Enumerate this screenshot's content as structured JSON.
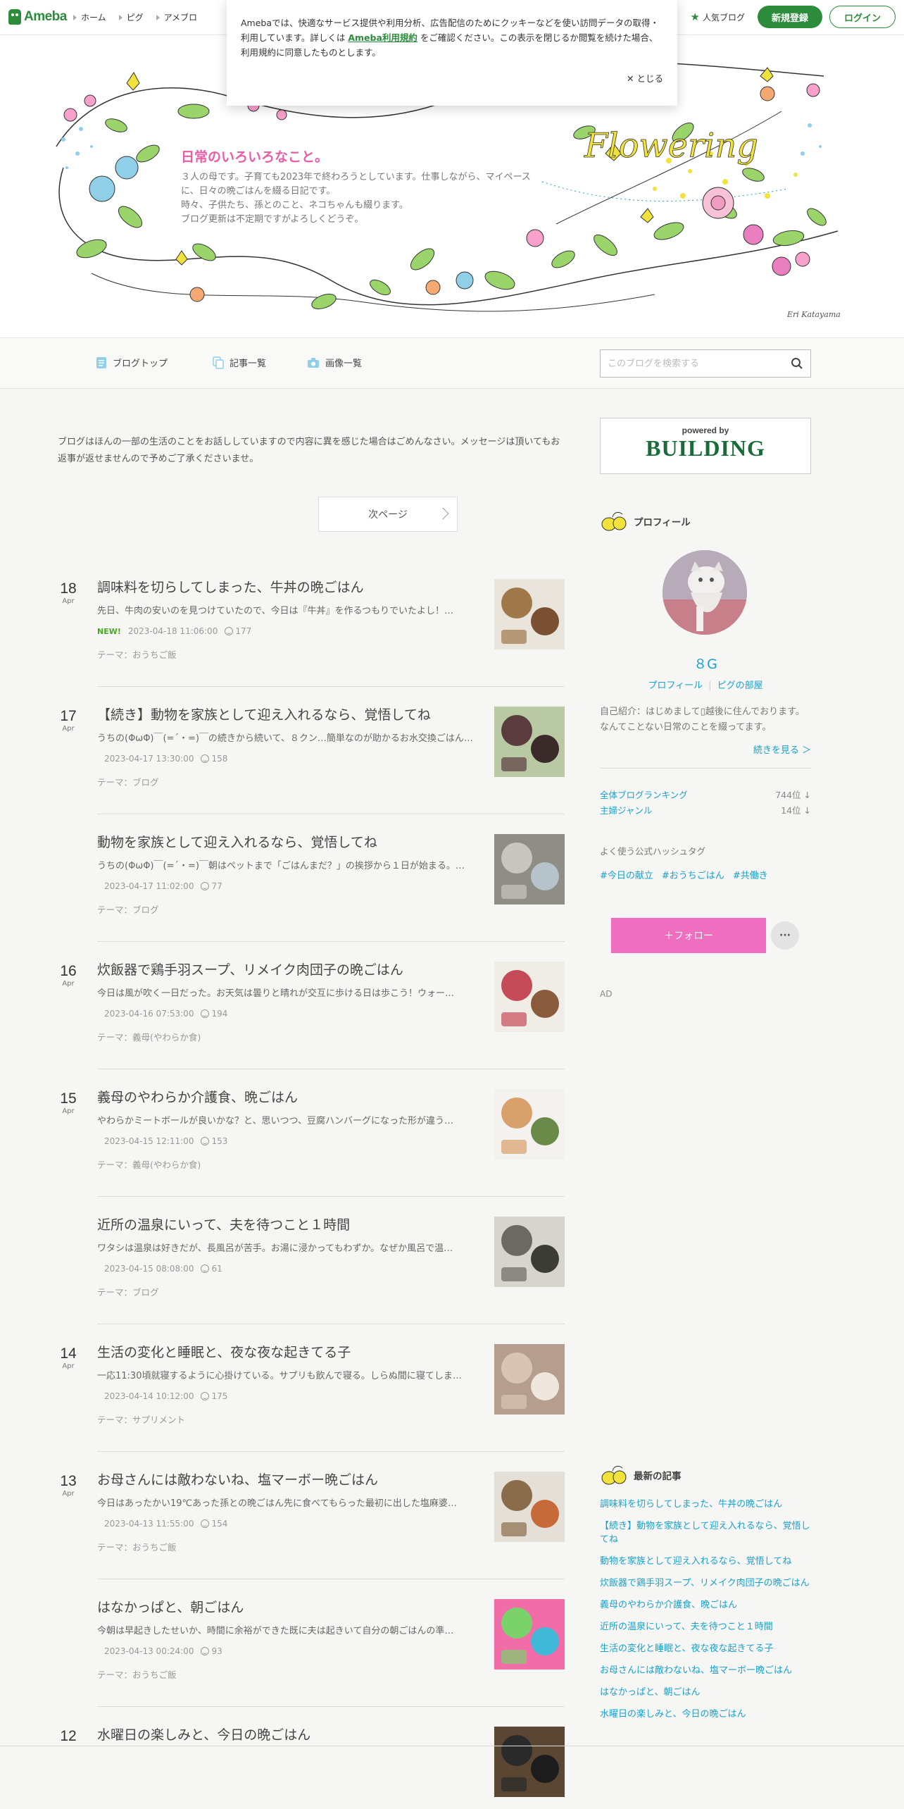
{
  "topbar": {
    "logo": "Ameba",
    "nav": [
      "ホーム",
      "ピグ",
      "アメブロ"
    ],
    "popular": "人気ブログ",
    "signup": "新規登録",
    "login": "ログイン"
  },
  "cookie": {
    "text_before": "Amebaでは、快適なサービス提供や利用分析、広告配信のためにクッキーなどを使い訪問データの取得・利用しています。詳しくは ",
    "link": "Ameba利用規約",
    "text_after": " をご確認ください。この表示を閉じるか閲覧を続けた場合、利用規約に同意したものとします。",
    "close": "とじる"
  },
  "header": {
    "title": "日常のいろいろなこと。",
    "description": "３人の母です。子育ても2023年で終わろうとしています。仕事しながら、マイペースに、日々の晩ごはんを綴る日記です。\n時々、子供たち、孫とのこと、ネコちゃんも綴ります。\nブログ更新は不定期ですがよろしくどうぞ。",
    "banner_word": "Flowering",
    "signature": "Eri Katayama"
  },
  "subnav": {
    "items": [
      "ブログトップ",
      "記事一覧",
      "画像一覧"
    ],
    "search_placeholder": "このブログを検索する"
  },
  "main": {
    "notice": "ブログはほんの一部の生活のことをお話ししていますので内容に異を感じた場合はごめんなさい。メッセージは頂いてもお返事が返せませんので予めご了承くださいませ。",
    "next_page": "次ページ",
    "entries": [
      {
        "day": "18",
        "month": "Apr",
        "title": "調味料を切らしてしまった、牛丼の晩ごはん",
        "excerpt": "先日、牛肉の安いのを見つけていたので、今日は『牛丼』を作るつもりでいたよし！…",
        "new": "NEW!",
        "datetime": "2023-04-18 11:06:00",
        "likes": "177",
        "theme": "テーマ：おうちご飯"
      },
      {
        "day": "17",
        "month": "Apr",
        "title": "【続き】動物を家族として迎え入れるなら、覚悟してね",
        "excerpt": "うちの(ΦωΦ)￣(=´・=)￣の続きから続いて、８クン…簡単なのが助かるお水交換ごはん…",
        "new": "",
        "datetime": "2023-04-17 13:30:00",
        "likes": "158",
        "theme": "テーマ：ブログ"
      },
      {
        "day": "",
        "month": "",
        "title": "動物を家族として迎え入れるなら、覚悟してね",
        "excerpt": "うちの(ΦωΦ)￣(=´・=)￣朝はペットまで「ごはんまだ？」の挨拶から１日が始まる。…",
        "new": "",
        "datetime": "2023-04-17 11:02:00",
        "likes": "77",
        "theme": "テーマ：ブログ"
      },
      {
        "day": "16",
        "month": "Apr",
        "title": "炊飯器で鶏手羽スープ、リメイク肉団子の晩ごはん",
        "excerpt": "今日は風が吹く一日だった。お天気は曇りと晴れが交互に歩ける日は歩こう！ウォー…",
        "new": "",
        "datetime": "2023-04-16 07:53:00",
        "likes": "194",
        "theme": "テーマ：義母(やわらか食)"
      },
      {
        "day": "15",
        "month": "Apr",
        "title": "義母のやわらか介護食、晩ごはん",
        "excerpt": "やわらかミートボールが良いかな？と、思いつつ、豆腐ハンバーグになった形が違う…",
        "new": "",
        "datetime": "2023-04-15 12:11:00",
        "likes": "153",
        "theme": "テーマ：義母(やわらか食)"
      },
      {
        "day": "",
        "month": "",
        "title": "近所の温泉にいって、夫を待つこと１時間",
        "excerpt": "ワタシは温泉は好きだが、長風呂が苦手。お湯に浸かってもわずか。なぜか風呂で温…",
        "new": "",
        "datetime": "2023-04-15 08:08:00",
        "likes": "61",
        "theme": "テーマ：ブログ"
      },
      {
        "day": "14",
        "month": "Apr",
        "title": "生活の変化と睡眠と、夜な夜な起きてる子",
        "excerpt": "一応11:30頃就寝するように心掛けている。サプリも飲んで寝る。しらぬ間に寝てしま…",
        "new": "",
        "datetime": "2023-04-14 10:12:00",
        "likes": "175",
        "theme": "テーマ：サプリメント"
      },
      {
        "day": "13",
        "month": "Apr",
        "title": "お母さんには敵わないね、塩マーボー晩ごはん",
        "excerpt": "今日はあったかい19℃あった孫との晩ごはん先に食べてもらった最初に出した塩麻婆…",
        "new": "",
        "datetime": "2023-04-13 11:55:00",
        "likes": "154",
        "theme": "テーマ：おうちご飯"
      },
      {
        "day": "",
        "month": "",
        "title": "はなかっぱと、朝ごはん",
        "excerpt": "今朝は早起きしたせいか、時間に余裕ができた既に夫は起きいて自分の朝ごはんの準…",
        "new": "",
        "datetime": "2023-04-13 00:24:00",
        "likes": "93",
        "theme": "テーマ：おうちご飯"
      },
      {
        "day": "12",
        "month": "",
        "title": "水曜日の楽しみと、今日の晩ごはん",
        "excerpt": "",
        "new": "",
        "datetime": "",
        "likes": "",
        "theme": ""
      }
    ]
  },
  "sidebar": {
    "ad_powered": "powered by",
    "ad_brand": "BUILDING",
    "profile_head": "プロフィール",
    "name": "８G",
    "profile_link": "プロフィール",
    "pig_link": "ピグの部屋",
    "intro": "自己紹介：はじめまして▯越後に住んでおります。 なんてことない日常のことを綴ってます。",
    "read_more": "続きを見る ＞",
    "ranking_label": "全体ブログランキング",
    "ranking_value": "744位 ↓",
    "genre_label": "主婦ジャンル",
    "genre_value": "14位 ↓",
    "hashtag_head": "よく使う公式ハッシュタグ",
    "hashtags": [
      "#今日の献立",
      "#おうちごはん",
      "#共働き"
    ],
    "follow": "＋フォロー",
    "more": "···",
    "ad_label": "AD",
    "latest_head": "最新の記事",
    "latest": [
      "調味料を切らしてしまった、牛丼の晩ごはん",
      "【続き】動物を家族として迎え入れるなら、覚悟してね",
      "動物を家族として迎え入れるなら、覚悟してね",
      "炊飯器で鶏手羽スープ、リメイク肉団子の晩ごはん",
      "義母のやわらか介護食、晩ごはん",
      "近所の温泉にいって、夫を待つこと１時間",
      "生活の変化と睡眠と、夜な夜な起きてる子",
      "お母さんには敵わないね、塩マーボー晩ごはん",
      "はなかっぱと、朝ごはん",
      "水曜日の楽しみと、今日の晩ごはん"
    ]
  },
  "colors": {
    "brand_green": "#2d8c3c",
    "link_blue": "#1aa1c8",
    "title_pink": "#e85da5",
    "follow_pink": "#ef6ec0"
  }
}
